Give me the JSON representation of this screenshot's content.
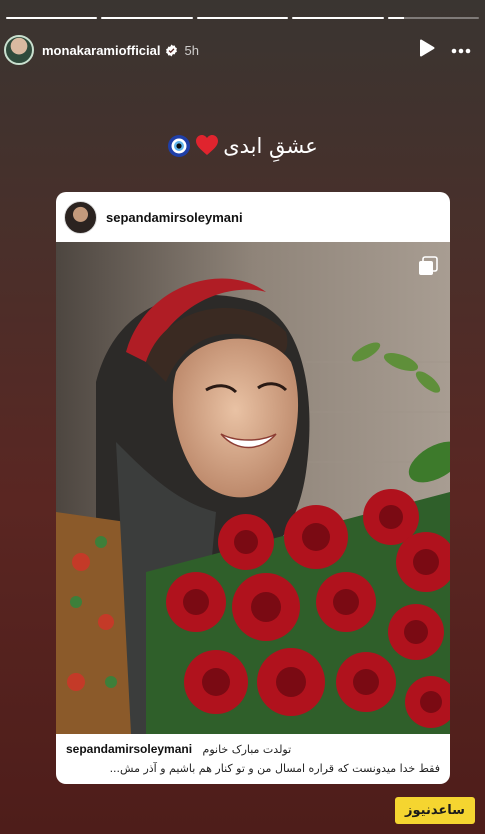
{
  "story": {
    "progress": [
      1,
      1,
      1,
      1,
      0.18
    ],
    "username": "monakaramiofficial",
    "time": "5h",
    "caption": "عشقِ ابدی"
  },
  "shared_post": {
    "username": "sepandamirsoleymani",
    "caption_user": "sepandamirsoleymani",
    "caption_line1": "تولدت مبارک خانوم",
    "caption_line2": "فقط خدا میدونست که قراره امسال من و تو کنار هم باشیم و آذر مش..."
  },
  "watermark": {
    "text": "ساعدنیوز"
  },
  "icons": [
    "verified-badge-icon",
    "play-icon",
    "more-icon",
    "evil-eye-icon",
    "red-heart-icon",
    "multiple-photos-icon"
  ],
  "colors": {
    "background_top": "#3a3531",
    "background_bottom": "#4e1d1a",
    "watermark": "#f5d530",
    "heart": "#e0242e",
    "verified": "#ffffff"
  }
}
